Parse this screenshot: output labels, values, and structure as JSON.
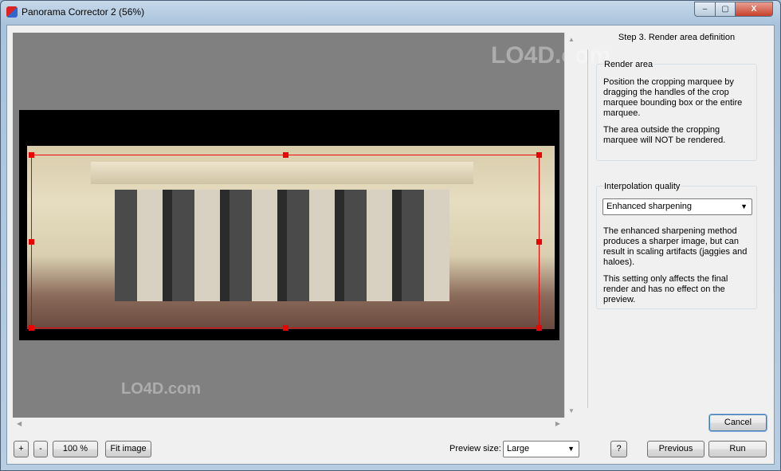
{
  "window": {
    "title": "Panorama Corrector 2 (56%)",
    "minimize": "–",
    "maximize": "▢",
    "close": "X"
  },
  "panel": {
    "step_title": "Step 3. Render area definition",
    "render_area": {
      "label": "Render area",
      "text1": "Position the cropping marquee by dragging the handles of the crop marquee bounding box or the entire marquee.",
      "text2": "The area outside the cropping marquee will NOT be rendered."
    },
    "interpolation": {
      "label": "Interpolation quality",
      "selected": "Enhanced sharpening",
      "text1": "The enhanced sharpening method produces a sharper image, but can result in scaling artifacts (jaggies and haloes).",
      "text2": "This setting only affects the final render and has no effect on the preview."
    }
  },
  "toolbar": {
    "zoom_in": "+",
    "zoom_out": "-",
    "zoom_100": "100 %",
    "fit_image": "Fit image",
    "preview_size_label": "Preview size:",
    "preview_size": "Large",
    "help": "?",
    "previous": "Previous",
    "run": "Run",
    "cancel": "Cancel"
  },
  "watermark": "LO4D.com",
  "colors": {
    "crop_marquee": "#ee0000",
    "preview_bg": "#808080"
  }
}
